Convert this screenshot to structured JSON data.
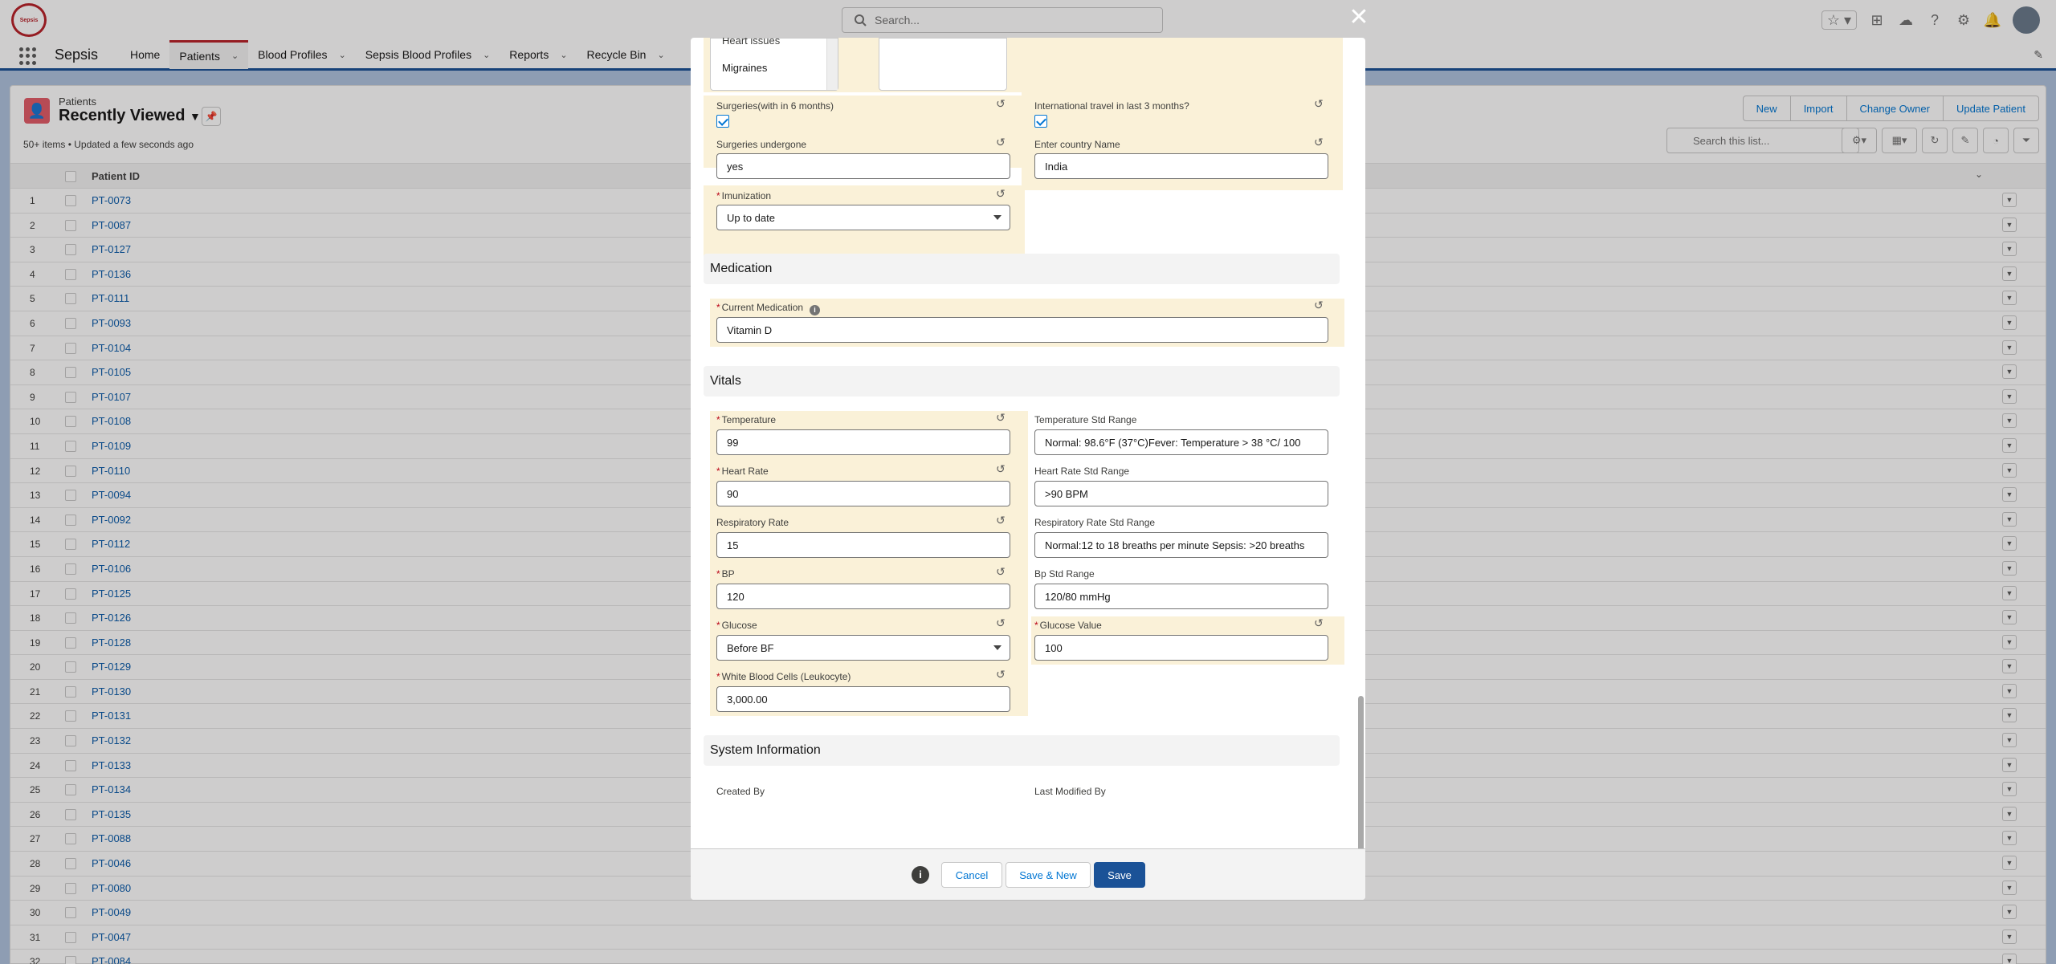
{
  "header": {
    "logo_text": "Sepsis",
    "search_placeholder": "Search..."
  },
  "nav": {
    "app_name": "Sepsis",
    "items": [
      {
        "label": "Home",
        "dropdown": false
      },
      {
        "label": "Patients",
        "dropdown": true
      },
      {
        "label": "Blood Profiles",
        "dropdown": true
      },
      {
        "label": "Sepsis Blood Profiles",
        "dropdown": true
      },
      {
        "label": "Reports",
        "dropdown": true
      },
      {
        "label": "Recycle Bin",
        "dropdown": true
      }
    ]
  },
  "list": {
    "object_label": "Patients",
    "view_name": "Recently Viewed",
    "meta": "50+ items • Updated a few seconds ago",
    "buttons": [
      "New",
      "Import",
      "Change Owner",
      "Update Patient"
    ],
    "search_placeholder": "Search this list...",
    "column_header": "Patient ID",
    "rows": [
      {
        "num": "1",
        "id": "PT-0073"
      },
      {
        "num": "2",
        "id": "PT-0087"
      },
      {
        "num": "3",
        "id": "PT-0127"
      },
      {
        "num": "4",
        "id": "PT-0136"
      },
      {
        "num": "5",
        "id": "PT-0111"
      },
      {
        "num": "6",
        "id": "PT-0093"
      },
      {
        "num": "7",
        "id": "PT-0104"
      },
      {
        "num": "8",
        "id": "PT-0105"
      },
      {
        "num": "9",
        "id": "PT-0107"
      },
      {
        "num": "10",
        "id": "PT-0108"
      },
      {
        "num": "11",
        "id": "PT-0109"
      },
      {
        "num": "12",
        "id": "PT-0110"
      },
      {
        "num": "13",
        "id": "PT-0094"
      },
      {
        "num": "14",
        "id": "PT-0092"
      },
      {
        "num": "15",
        "id": "PT-0112"
      },
      {
        "num": "16",
        "id": "PT-0106"
      },
      {
        "num": "17",
        "id": "PT-0125"
      },
      {
        "num": "18",
        "id": "PT-0126"
      },
      {
        "num": "19",
        "id": "PT-0128"
      },
      {
        "num": "20",
        "id": "PT-0129"
      },
      {
        "num": "21",
        "id": "PT-0130"
      },
      {
        "num": "22",
        "id": "PT-0131"
      },
      {
        "num": "23",
        "id": "PT-0132"
      },
      {
        "num": "24",
        "id": "PT-0133"
      },
      {
        "num": "25",
        "id": "PT-0134"
      },
      {
        "num": "26",
        "id": "PT-0135"
      },
      {
        "num": "27",
        "id": "PT-0088"
      },
      {
        "num": "28",
        "id": "PT-0046"
      },
      {
        "num": "29",
        "id": "PT-0080"
      },
      {
        "num": "30",
        "id": "PT-0049"
      },
      {
        "num": "31",
        "id": "PT-0047"
      },
      {
        "num": "32",
        "id": "PT-0084"
      }
    ]
  },
  "modal": {
    "history_options": [
      "Heart issues",
      "Migraines"
    ],
    "surgeries_6m_label": "Surgeries(with in 6 months)",
    "surgeries_6m_checked": true,
    "intl_travel_label": "International travel in last 3 months?",
    "intl_travel_checked": true,
    "surgeries_undergone_label": "Surgeries undergone",
    "surgeries_undergone_value": "yes",
    "country_label": "Enter country Name",
    "country_value": "India",
    "immunization_label": "Imunization",
    "immunization_value": "Up to date",
    "medication_section": "Medication",
    "current_medication_label": "Current Medication",
    "current_medication_value": "Vitamin D",
    "vitals_section": "Vitals",
    "temperature_label": "Temperature",
    "temperature_value": "99",
    "temp_range_label": "Temperature Std Range",
    "temp_range_value": "Normal: 98.6°F (37°C)Fever: Temperature > 38 °C/ 100",
    "heart_rate_label": "Heart Rate",
    "heart_rate_value": "90",
    "hr_range_label": "Heart Rate Std Range",
    "hr_range_value": ">90 BPM",
    "resp_rate_label": "Respiratory Rate",
    "resp_rate_value": "15",
    "rr_range_label": "Respiratory Rate Std Range",
    "rr_range_value": "Normal:12 to 18 breaths per minute Sepsis: >20 breaths",
    "bp_label": "BP",
    "bp_value": "120",
    "bp_range_label": "Bp Std Range",
    "bp_range_value": "120/80 mmHg",
    "glucose_label": "Glucose",
    "glucose_value": "Before BF",
    "glucose_value_label": "Glucose Value",
    "glucose_value_value": "100",
    "wbc_label": "White Blood Cells (Leukocyte)",
    "wbc_value": "3,000.00",
    "system_section": "System Information",
    "created_by_label": "Created By",
    "last_modified_label": "Last Modified By",
    "footer": {
      "cancel": "Cancel",
      "save_new": "Save & New",
      "save": "Save"
    }
  },
  "colors": {
    "brand": "#1b5297",
    "highlight": "#faf1d8",
    "link": "#0176d3",
    "object_icon": "#e35d6a"
  }
}
